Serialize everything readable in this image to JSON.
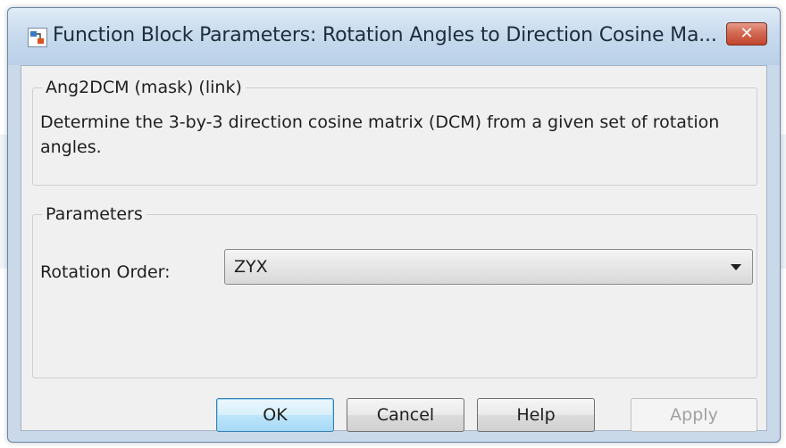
{
  "window": {
    "title": "Function Block Parameters: Rotation Angles to Direction Cosine Ma...",
    "close_label": "✕"
  },
  "mask_group": {
    "legend": "Ang2DCM (mask) (link)",
    "description": "Determine the 3-by-3 direction cosine matrix (DCM) from a given set of rotation angles."
  },
  "parameters_group": {
    "legend": "Parameters",
    "rotation_order": {
      "label": "Rotation Order:",
      "value": "ZYX"
    }
  },
  "buttons": {
    "ok": "OK",
    "cancel": "Cancel",
    "help": "Help",
    "apply": "Apply"
  },
  "icons": {
    "app_icon": "simulink-block-icon",
    "close_icon": "close-icon",
    "dropdown_icon": "chevron-down-icon"
  },
  "colors": {
    "close_button": "#c2452d",
    "default_button_border": "#3c7fb1",
    "disabled_text": "#a0a0a0"
  }
}
